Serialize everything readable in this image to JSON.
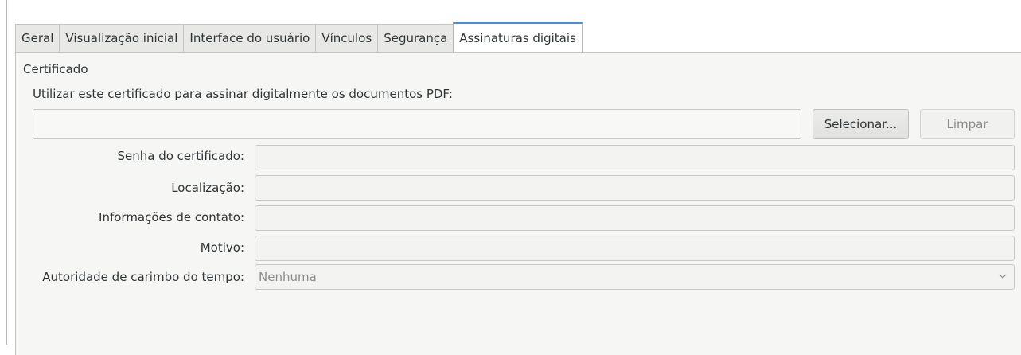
{
  "tabs": [
    {
      "label": "Geral",
      "active": false
    },
    {
      "label": "Visualização inicial",
      "active": false
    },
    {
      "label": "Interface do usuário",
      "active": false
    },
    {
      "label": "Vínculos",
      "active": false
    },
    {
      "label": "Segurança",
      "active": false
    },
    {
      "label": "Assinaturas digitais",
      "active": true
    }
  ],
  "certificate": {
    "section_title": "Certificado",
    "instruction": "Utilizar este certificado para assinar digitalmente os documentos PDF:",
    "certificate_value": "",
    "select_button": "Selecionar...",
    "clear_button": "Limpar"
  },
  "form": {
    "password_label": "Senha do certificado:",
    "password_value": "",
    "location_label": "Localização:",
    "location_value": "",
    "contact_label": "Informações de contato:",
    "contact_value": "",
    "reason_label": "Motivo:",
    "reason_value": "",
    "tsa_label": "Autoridade de carimbo do tempo:",
    "tsa_value": "Nenhuma"
  },
  "icons": {
    "dropdown": "chevron-down-icon"
  },
  "colors": {
    "active_tab_accent": "#4a90d9",
    "panel_background": "#f6f6f5"
  }
}
